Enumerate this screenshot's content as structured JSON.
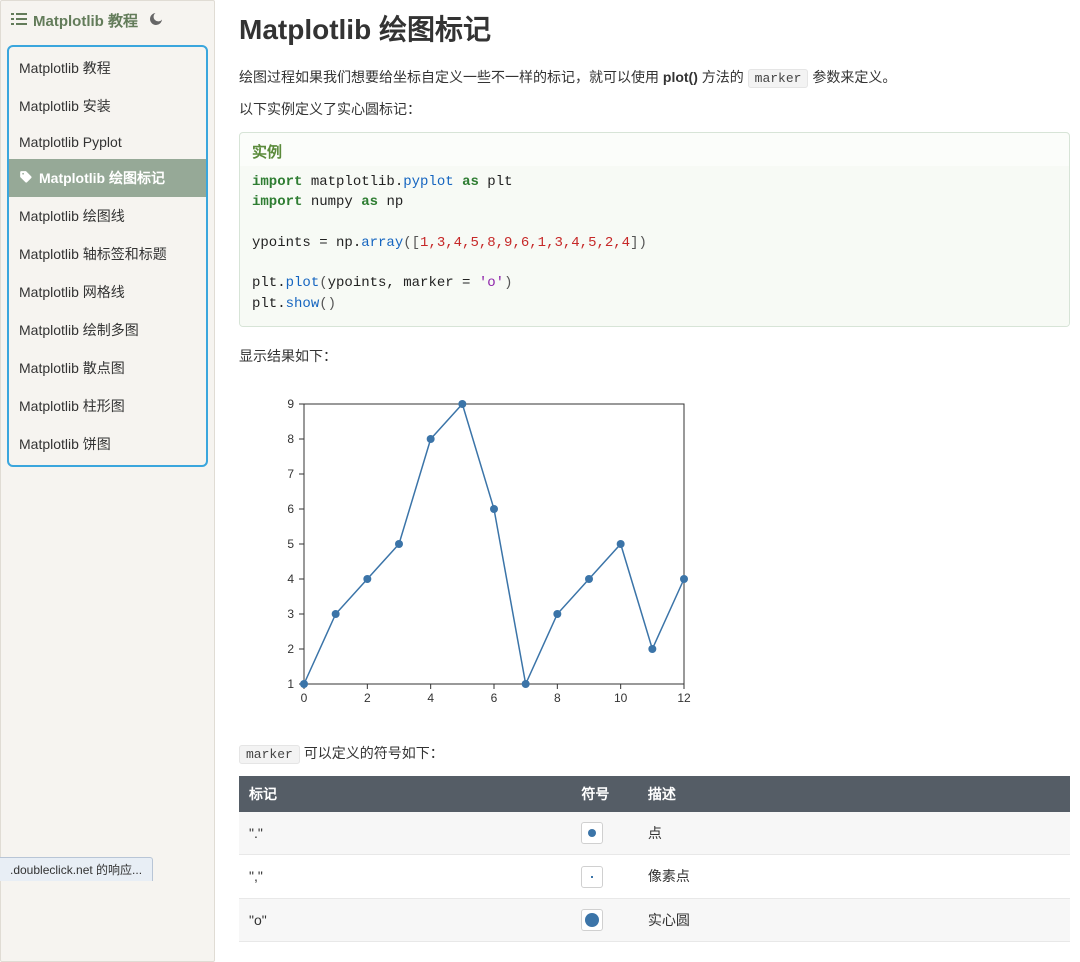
{
  "sidebar": {
    "title": "Matplotlib 教程",
    "items": [
      {
        "label": "Matplotlib 教程"
      },
      {
        "label": "Matplotlib 安装"
      },
      {
        "label": "Matplotlib Pyplot"
      },
      {
        "label": "Matplotlib 绘图标记",
        "active": true
      },
      {
        "label": "Matplotlib 绘图线"
      },
      {
        "label": "Matplotlib 轴标签和标题"
      },
      {
        "label": "Matplotlib 网格线"
      },
      {
        "label": "Matplotlib 绘制多图"
      },
      {
        "label": "Matplotlib 散点图"
      },
      {
        "label": "Matplotlib 柱形图"
      },
      {
        "label": "Matplotlib 饼图"
      }
    ]
  },
  "page": {
    "title": "Matplotlib 绘图标记",
    "intro_pre": "绘图过程如果我们想要给坐标自定义一些不一样的标记，就可以使用 ",
    "intro_plot": "plot()",
    "intro_mid": " 方法的 ",
    "intro_marker": "marker",
    "intro_post": " 参数来定义。",
    "intro2": "以下实例定义了实心圆标记：",
    "example_label": "实例",
    "result_label": "显示结果如下：",
    "table_intro_pre": "",
    "table_intro_marker": "marker",
    "table_intro_post": " 可以定义的符号如下："
  },
  "code": {
    "line1": {
      "kw1": "import",
      "t1": " matplotlib.",
      "attr1": "pyplot",
      "kw2": " as",
      "t2": " plt"
    },
    "line2": {
      "kw1": "import",
      "t1": " numpy ",
      "kw2": "as",
      "t2": " np"
    },
    "line3": {
      "t1": "ypoints = np.",
      "attr1": "array",
      "p1": "([",
      "nums": "1,3,4,5,8,9,6,1,3,4,5,2,4",
      "p2": "])"
    },
    "line4": {
      "t1": "plt.",
      "attr1": "plot",
      "p1": "(",
      "t2": "ypoints, marker = ",
      "str1": "'o'",
      "p2": ")"
    },
    "line5": {
      "t1": "plt.",
      "attr1": "show",
      "p1": "()"
    }
  },
  "chart_data": {
    "type": "line",
    "x": [
      0,
      1,
      2,
      3,
      4,
      5,
      6,
      7,
      8,
      9,
      10,
      11,
      12
    ],
    "y": [
      1,
      3,
      4,
      5,
      8,
      9,
      6,
      1,
      3,
      4,
      5,
      2,
      4
    ],
    "xlim": [
      0,
      12
    ],
    "ylim": [
      1,
      9
    ],
    "xticks": [
      0,
      2,
      4,
      6,
      8,
      10,
      12
    ],
    "yticks": [
      1,
      2,
      3,
      4,
      5,
      6,
      7,
      8,
      9
    ],
    "marker": "o"
  },
  "table": {
    "headers": [
      "标记",
      "符号",
      "描述"
    ],
    "rows": [
      {
        "mark": "\".\"",
        "symbol": "dot-small",
        "desc": "点"
      },
      {
        "mark": "\",\"",
        "symbol": "dot-pixel",
        "desc": "像素点"
      },
      {
        "mark": "\"o\"",
        "symbol": "dot-big",
        "desc": "实心圆"
      }
    ]
  },
  "status_bar": ".doubleclick.net 的响应..."
}
